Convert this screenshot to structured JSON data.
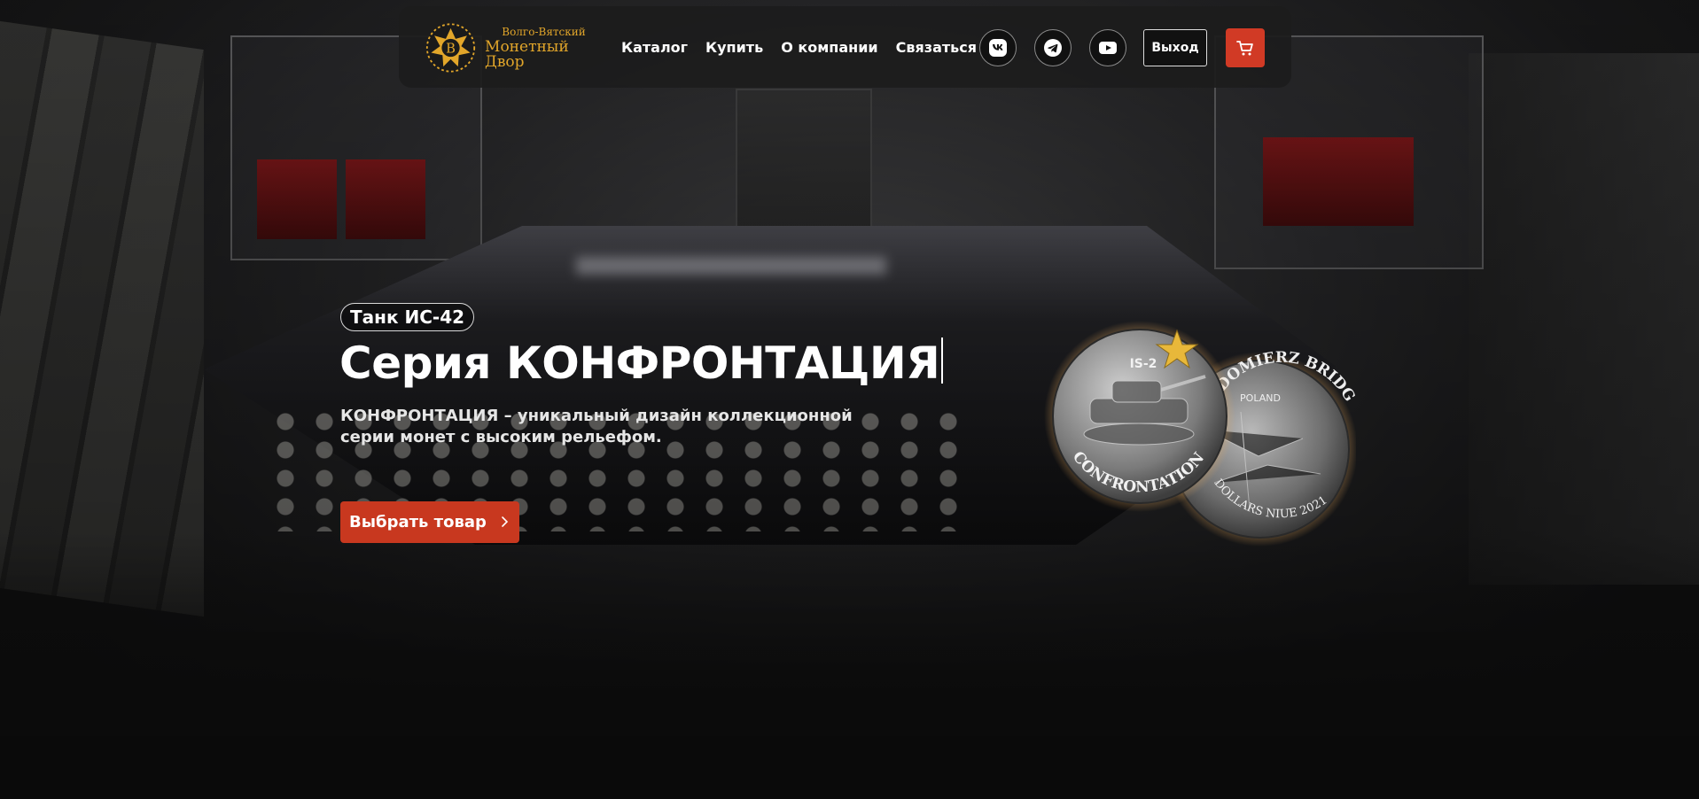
{
  "logo": {
    "line1": "Волго-Вятский",
    "line2": "Монетный Двор",
    "emblem_letter": "В"
  },
  "menu": {
    "items": [
      "Каталог",
      "Купить",
      "О компании",
      "Связаться"
    ]
  },
  "social": {
    "vk_icon": "vk-icon",
    "telegram_icon": "telegram-icon",
    "youtube_icon": "youtube-icon"
  },
  "header": {
    "logout_label": "Выход",
    "cart_icon": "cart-icon"
  },
  "hero": {
    "tag": "Танк ИС-42",
    "title": "Серия КОНФРОНТАЦИЯ",
    "description": "КОНФРОНТАЦИЯ – уникальный дизайн коллекционной серии монет с высоким рельефом.",
    "cta_label": "Выбрать товар"
  },
  "coins": {
    "front_top": "IS-2",
    "front_bottom": "CONFRONTATION",
    "back_top": "SANDOMIERZ BRIDGEHEAD",
    "back_country": "POLAND",
    "back_bottom": "DOLLARS NIUE 2021"
  },
  "colors": {
    "accent": "#c8381f",
    "cart": "#d13a25",
    "logo_gold": "#e2a62a",
    "nav_bg": "#1c1c1c"
  }
}
